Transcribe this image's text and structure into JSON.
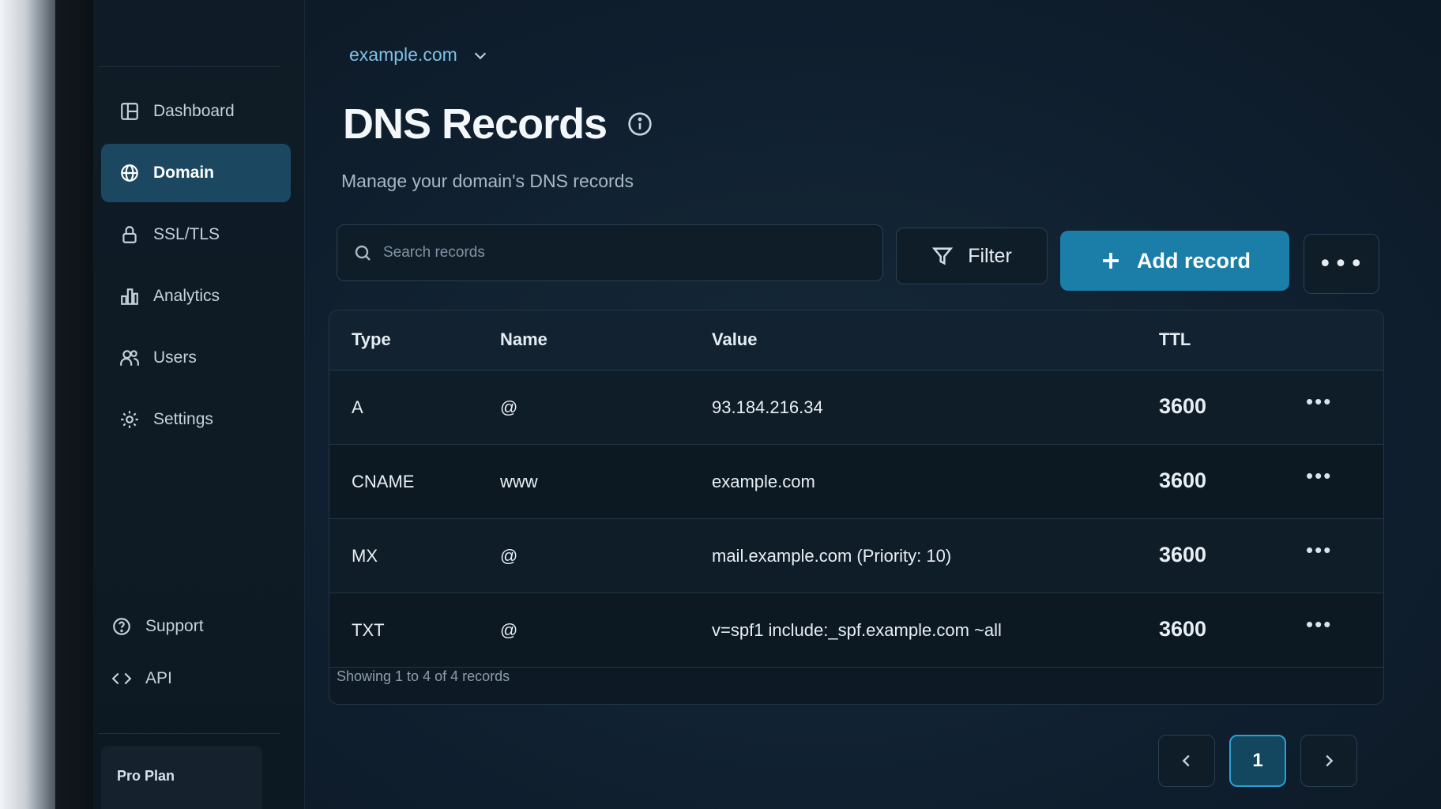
{
  "sidebar": {
    "items": [
      {
        "label": "Dashboard",
        "icon": "layout-icon"
      },
      {
        "label": "Domain",
        "icon": "globe-icon",
        "active": true
      },
      {
        "label": "SSL/TLS",
        "icon": "lock-icon"
      },
      {
        "label": "Analytics",
        "icon": "bar-chart-icon"
      },
      {
        "label": "Users",
        "icon": "users-icon"
      },
      {
        "label": "Settings",
        "icon": "gear-icon"
      }
    ],
    "bottom_items": [
      {
        "label": "Support",
        "icon": "help-circle-icon"
      },
      {
        "label": "API",
        "icon": "code-icon"
      }
    ],
    "plan": "Pro Plan"
  },
  "header": {
    "domain": "example.com",
    "title": "DNS Records",
    "subtitle": "Manage your domain's DNS records"
  },
  "toolbar": {
    "search_placeholder": "Search records",
    "filter_label": "Filter",
    "add_label": "Add record",
    "more_label": "•••"
  },
  "table": {
    "columns": {
      "type": "Type",
      "name": "Name",
      "value": "Value",
      "ttl": "TTL"
    },
    "rows": [
      {
        "type": "A",
        "name": "@",
        "value": "93.184.216.34",
        "ttl": "3600"
      },
      {
        "type": "CNAME",
        "name": "www",
        "value": "example.com",
        "ttl": "3600"
      },
      {
        "type": "MX",
        "name": "@",
        "value": "mail.example.com (Priority: 10)",
        "ttl": "3600"
      },
      {
        "type": "TXT",
        "name": "@",
        "value": "v=spf1 include:_spf.example.com ~all",
        "ttl": "3600"
      }
    ],
    "row_action_label": "•••"
  },
  "footer": {
    "showing": "Showing 1 to 4 of 4 records",
    "current_page": "1"
  },
  "colors": {
    "accent": "#1a7ea8",
    "active_nav": "#1b4860",
    "domain_link": "#7fc1e4"
  }
}
